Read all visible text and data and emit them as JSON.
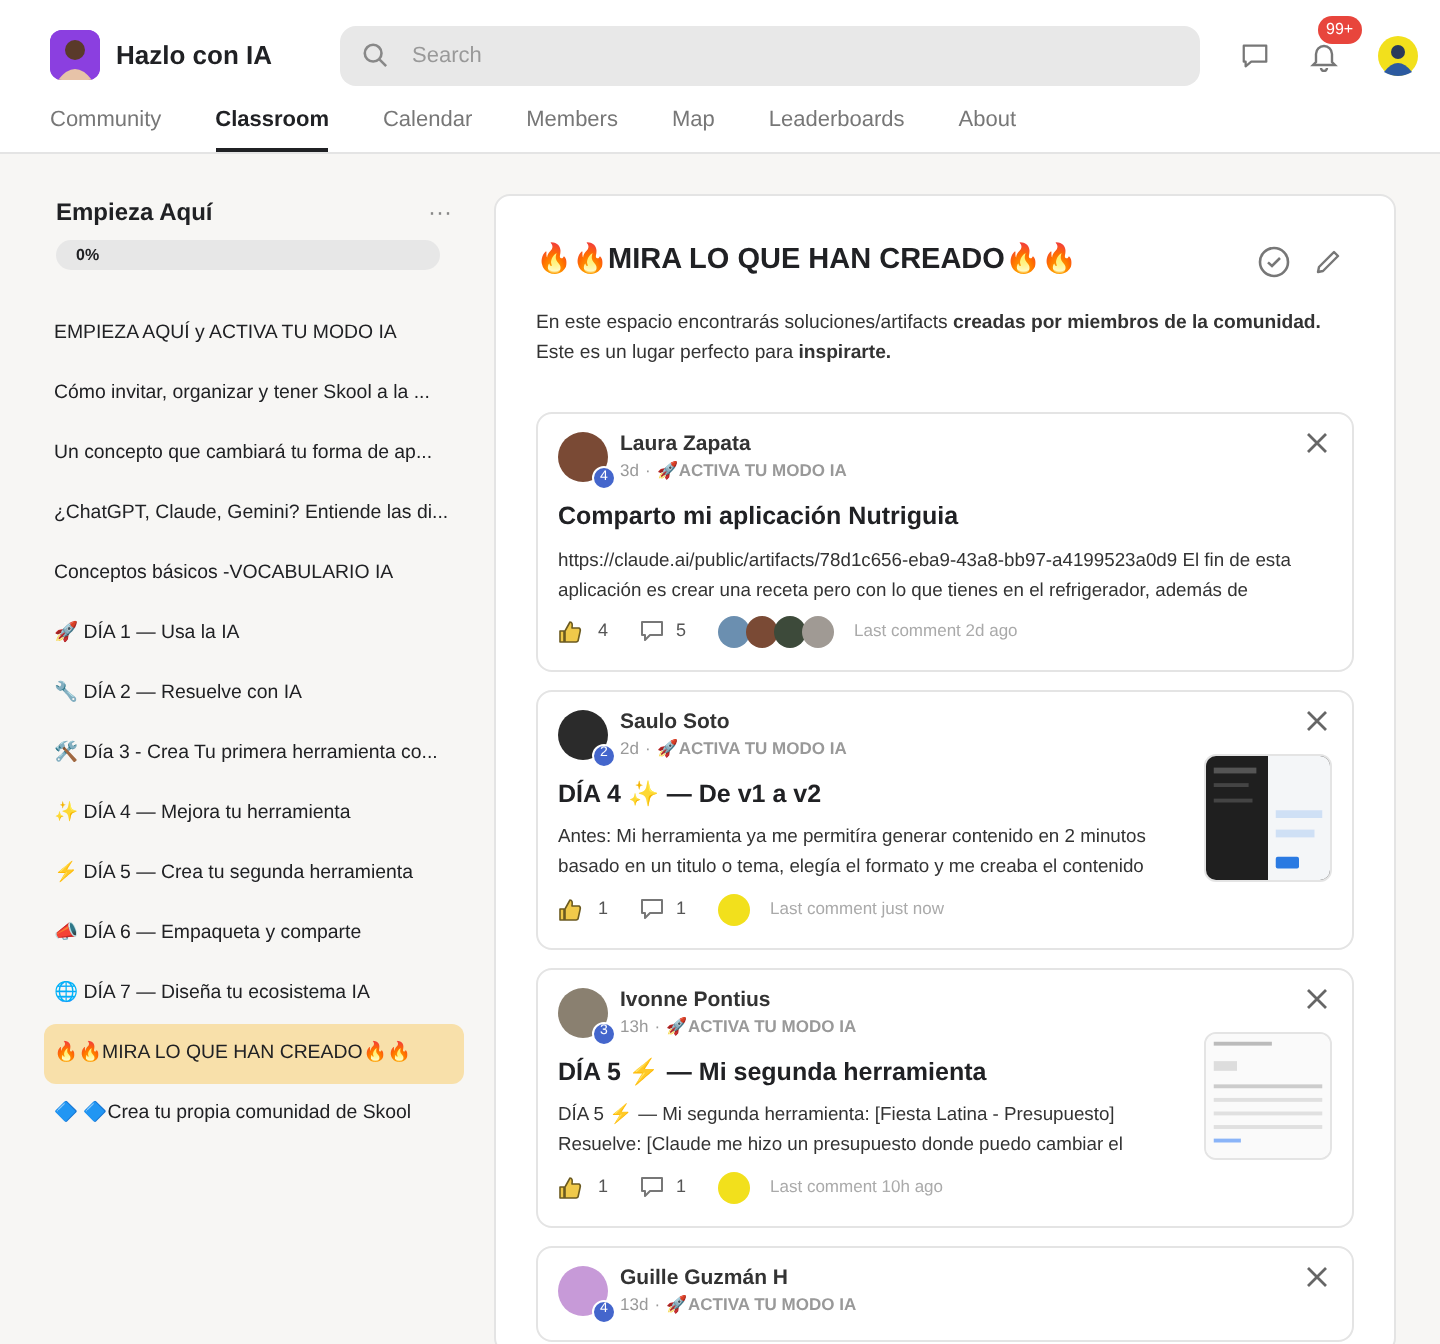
{
  "community": {
    "name": "Hazlo con IA"
  },
  "search": {
    "placeholder": "Search"
  },
  "notifications": {
    "badge": "99+"
  },
  "tabs": [
    {
      "label": "Community",
      "selected": false
    },
    {
      "label": "Classroom",
      "selected": true
    },
    {
      "label": "Calendar",
      "selected": false
    },
    {
      "label": "Members",
      "selected": false
    },
    {
      "label": "Map",
      "selected": false
    },
    {
      "label": "Leaderboards",
      "selected": false
    },
    {
      "label": "About",
      "selected": false
    }
  ],
  "course": {
    "title": "Empieza Aquí",
    "menu": "···",
    "progress_label": "0%",
    "level": 0,
    "lessons": [
      {
        "label": "EMPIEZA AQUÍ y ACTIVA TU MODO IA",
        "selected": false
      },
      {
        "label": "Cómo invitar, organizar y tener Skool a la ...",
        "selected": false
      },
      {
        "label": "Un concepto que cambiará tu forma de ap...",
        "selected": false
      },
      {
        "label": "¿ChatGPT, Claude, Gemini? Entiende las di...",
        "selected": false
      },
      {
        "label": "Conceptos básicos -VOCABULARIO IA",
        "selected": false
      },
      {
        "label": "🚀 DÍA 1 — Usa la IA",
        "selected": false
      },
      {
        "label": "🔧 DÍA 2 — Resuelve con IA",
        "selected": false
      },
      {
        "label": "🛠️ Día 3 - Crea Tu primera herramienta co...",
        "selected": false
      },
      {
        "label": "✨ DÍA 4 — Mejora tu herramienta",
        "selected": false
      },
      {
        "label": "⚡ DÍA 5 — Crea tu segunda herramienta",
        "selected": false
      },
      {
        "label": "📣 DÍA 6 — Empaqueta y comparte",
        "selected": false
      },
      {
        "label": "🌐 DÍA 7 — Diseña tu ecosistema IA",
        "selected": false
      },
      {
        "label": "🔥🔥MIRA LO QUE HAN CREADO🔥🔥",
        "selected": true
      },
      {
        "label": "🔷 🔷Crea tu propia comunidad de Skool",
        "selected": false
      }
    ]
  },
  "lesson": {
    "title": "🔥🔥MIRA LO QUE HAN CREADO🔥🔥",
    "description": "En este espacio encontrarás soluciones/artifacts **creadas por miembros de la comunidad.** Este es un lugar perfecto para **inspirarte.**",
    "posts": [
      {
        "author": "Laura Zapata",
        "level": "4",
        "time": "3d",
        "category": "🚀ACTIVA TU MODO IA",
        "title": "Comparto mi aplicación Nutriguia",
        "body": "https://claude.ai/public/artifacts/78d1c656-eba9-43a8-bb97-a4199523a0d9 El fin de esta aplicación es crear una receta pero con lo que tienes en el refrigerador, además de",
        "likes": "4",
        "comments": "5",
        "commenters": [
          {
            "color": "#6b8fb0"
          },
          {
            "color": "#7a4a35"
          },
          {
            "color": "#3d4a3a"
          },
          {
            "color": "#a09a94"
          }
        ],
        "last_comment": "Last comment 2d ago",
        "separator": "·"
      },
      {
        "author": "Saulo Soto",
        "level": "2",
        "time": "2d",
        "category": "🚀ACTIVA TU MODO IA",
        "title": "DÍA 4 ✨ — De v1 a v2",
        "body": "Antes: Mi herramienta ya me permitíra generar contenido en 2 minutos basado en un titulo o tema, elegía el formato y me creaba el contenido",
        "likes": "1",
        "comments": "1",
        "commenters": [
          {
            "color": "#f2e01c"
          }
        ],
        "last_comment": "Last comment just now",
        "separator": "·"
      },
      {
        "author": "Ivonne Pontius",
        "level": "3",
        "time": "13h",
        "category": "🚀ACTIVA TU MODO IA",
        "title": "DÍA 5 ⚡ — Mi segunda herramienta",
        "body": "DÍA 5 ⚡ — Mi segunda herramienta: [Fiesta Latina - Presupuesto] Resuelve: [Claude me hizo un presupuesto donde puedo cambiar el",
        "likes": "1",
        "comments": "1",
        "commenters": [
          {
            "color": "#f2e01c"
          }
        ],
        "last_comment": "Last comment 10h ago",
        "separator": "·"
      },
      {
        "author": "Guille Guzmán H",
        "level": "4",
        "time": "13d",
        "category": "🚀ACTIVA TU MODO IA",
        "separator": "·"
      }
    ]
  }
}
